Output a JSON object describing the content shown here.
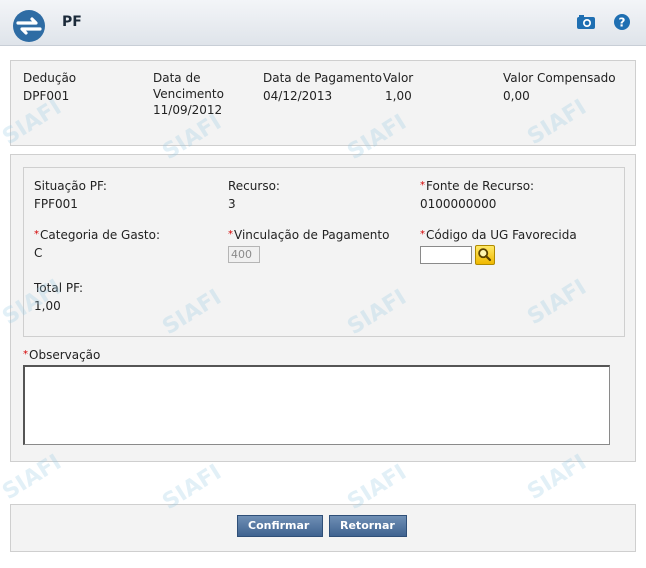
{
  "header": {
    "title": "PF",
    "camera_icon": "camera-icon",
    "help_icon": "help-icon"
  },
  "summary": {
    "deducao_label": "Dedução",
    "deducao_value": "DPF001",
    "vencimento_label_1": "Data de",
    "vencimento_label_2": "Vencimento",
    "vencimento_value": "11/09/2012",
    "pagamento_label": "Data de Pagamento",
    "pagamento_value": "04/12/2013",
    "valor_label": "Valor",
    "valor_value": "1,00",
    "compensado_label": "Valor Compensado",
    "compensado_value": "0,00"
  },
  "form": {
    "situacao_label": "Situação PF:",
    "situacao_value": "FPF001",
    "recurso_label": "Recurso:",
    "recurso_value": "3",
    "fonte_label": "Fonte de Recurso:",
    "fonte_value": "0100000000",
    "categoria_label": "Categoria de Gasto:",
    "categoria_value": "C",
    "vinculacao_label": "Vinculação de Pagamento",
    "vinculacao_value": "400",
    "ug_label": "Código da UG Favorecida",
    "ug_value": "",
    "total_label": "Total PF:",
    "total_value": "1,00",
    "observacao_label": "Observação",
    "observacao_value": ""
  },
  "buttons": {
    "confirmar": "Confirmar",
    "retornar": "Retornar"
  },
  "watermark": "SIAFI",
  "colors": {
    "accent": "#3f6390",
    "required": "#d40000",
    "logo": "#2e6ca4"
  }
}
